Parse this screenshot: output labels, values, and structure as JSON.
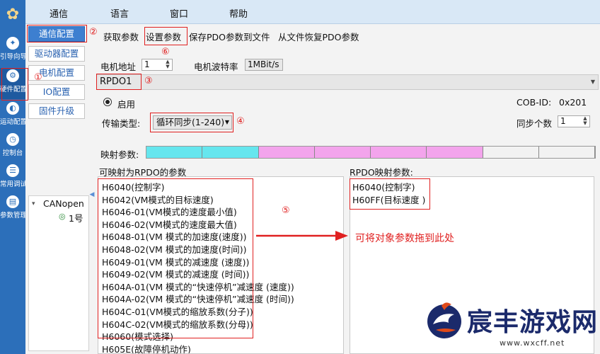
{
  "menu": [
    "通信",
    "语言",
    "窗口",
    "帮助"
  ],
  "rail": [
    "引导向导",
    "硬件配置",
    "运动配置",
    "控制台",
    "常用调试",
    "参数管理"
  ],
  "subnav": [
    "通信配置",
    "驱动器配置",
    "电机配置",
    "IO配置",
    "固件升级"
  ],
  "tree": {
    "root": "CANopen",
    "child": "1号"
  },
  "toolbar": [
    "获取参数",
    "设置参数",
    "保存PDO参数到文件",
    "从文件恢复PDO参数"
  ],
  "address": {
    "label": "电机地址",
    "value": "1"
  },
  "baud": {
    "label": "电机波特率",
    "value": "1MBit/s"
  },
  "rpdo": "RPDO1",
  "enable_label": "启用",
  "cob_id": {
    "label": "COB-ID:",
    "value": "0x201"
  },
  "transfer": {
    "label": "传输类型:",
    "value": "循环同步(1-240)"
  },
  "sync": {
    "label": "同步个数",
    "value": "1"
  },
  "map_label": "映射参数:",
  "map_segments": [
    "#66e6ee",
    "#66e6ee",
    "#f3a4ec",
    "#f3a4ec",
    "#f3a4ec",
    "#f3a4ec",
    "#f2f2f2",
    "#f2f2f2"
  ],
  "avail_title": "可映射为RPDO的参数",
  "avail_items": [
    "H6040(控制字)",
    "H6042(VM模式的目标速度)",
    "H6046-01(VM模式的速度最小值)",
    "H6046-02(VM模式的速度最大值)",
    "H6048-01(VM 模式的加速度(速度))",
    "H6048-02(VM 模式的加速度(时间))",
    "H6049-01(VM 模式的减速度 (速度))",
    "H6049-02(VM 模式的减速度 (时间))",
    "H604A-01(VM 模式的“快速停机”减速度 (速度))",
    "H604A-02(VM 模式的“快速停机”减速度 (时间))",
    "H604C-01(VM模式的缩放系数(分子))",
    "H604C-02(VM模式的缩放系数(分母))",
    "H6060(模式选择)",
    "H605E(故障停机动作)"
  ],
  "mapped_title": "RPDO映射参数:",
  "mapped_items": [
    "H6040(控制字)",
    "H60FF(目标速度 )"
  ],
  "annotations": {
    "n1": "①",
    "n2": "②",
    "n3": "③",
    "n4": "④",
    "n5": "⑤",
    "n6": "⑥",
    "drag_hint": "可将对象参数拖到此处"
  },
  "watermark": {
    "brand": "宸丰游戏网",
    "url": "www.wxcff.net"
  },
  "colors": {
    "annotation": "#e02020",
    "rail": "#2c6fba",
    "accent": "#3d7fd0"
  }
}
